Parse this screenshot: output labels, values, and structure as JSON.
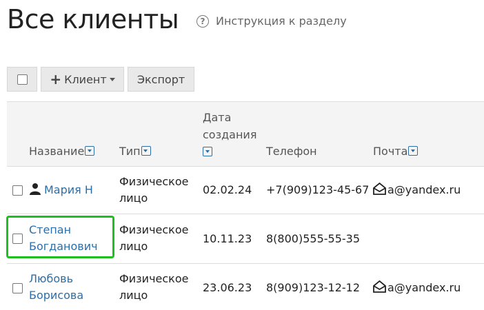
{
  "page": {
    "title": "Все клиенты",
    "help_link": "Инструкция к разделу"
  },
  "toolbar": {
    "client_label": "Клиент",
    "export_label": "Экспорт"
  },
  "table": {
    "columns": {
      "name": "Название",
      "type": "Тип",
      "created_line1": "Дата",
      "created_line2": "создания",
      "phone": "Телефон",
      "email": "Почта"
    },
    "rows": [
      {
        "name_line1": "Мария Н",
        "name_line2": "",
        "type_line1": "Физическое",
        "type_line2": "лицо",
        "date": "02.02.24",
        "phone": "+7(909)123-45-67",
        "email": "a@yandex.ru",
        "person_icon": "user-icon"
      },
      {
        "name_line1": "Степан",
        "name_line2": "Богданович",
        "type_line1": "Физическое",
        "type_line2": "лицо",
        "date": "10.11.23",
        "phone": "8(800)555-55-35",
        "email": ""
      },
      {
        "name_line1": "Любовь",
        "name_line2": "Борисова",
        "type_line1": "Физическое",
        "type_line2": "лицо",
        "date": "23.06.23",
        "phone": "8(909)123-12-12",
        "email": "a@yandex.ru"
      }
    ]
  },
  "colors": {
    "link": "#2b6ea8",
    "highlight": "#1fbf1f",
    "header_bg": "#f4f4f4"
  }
}
